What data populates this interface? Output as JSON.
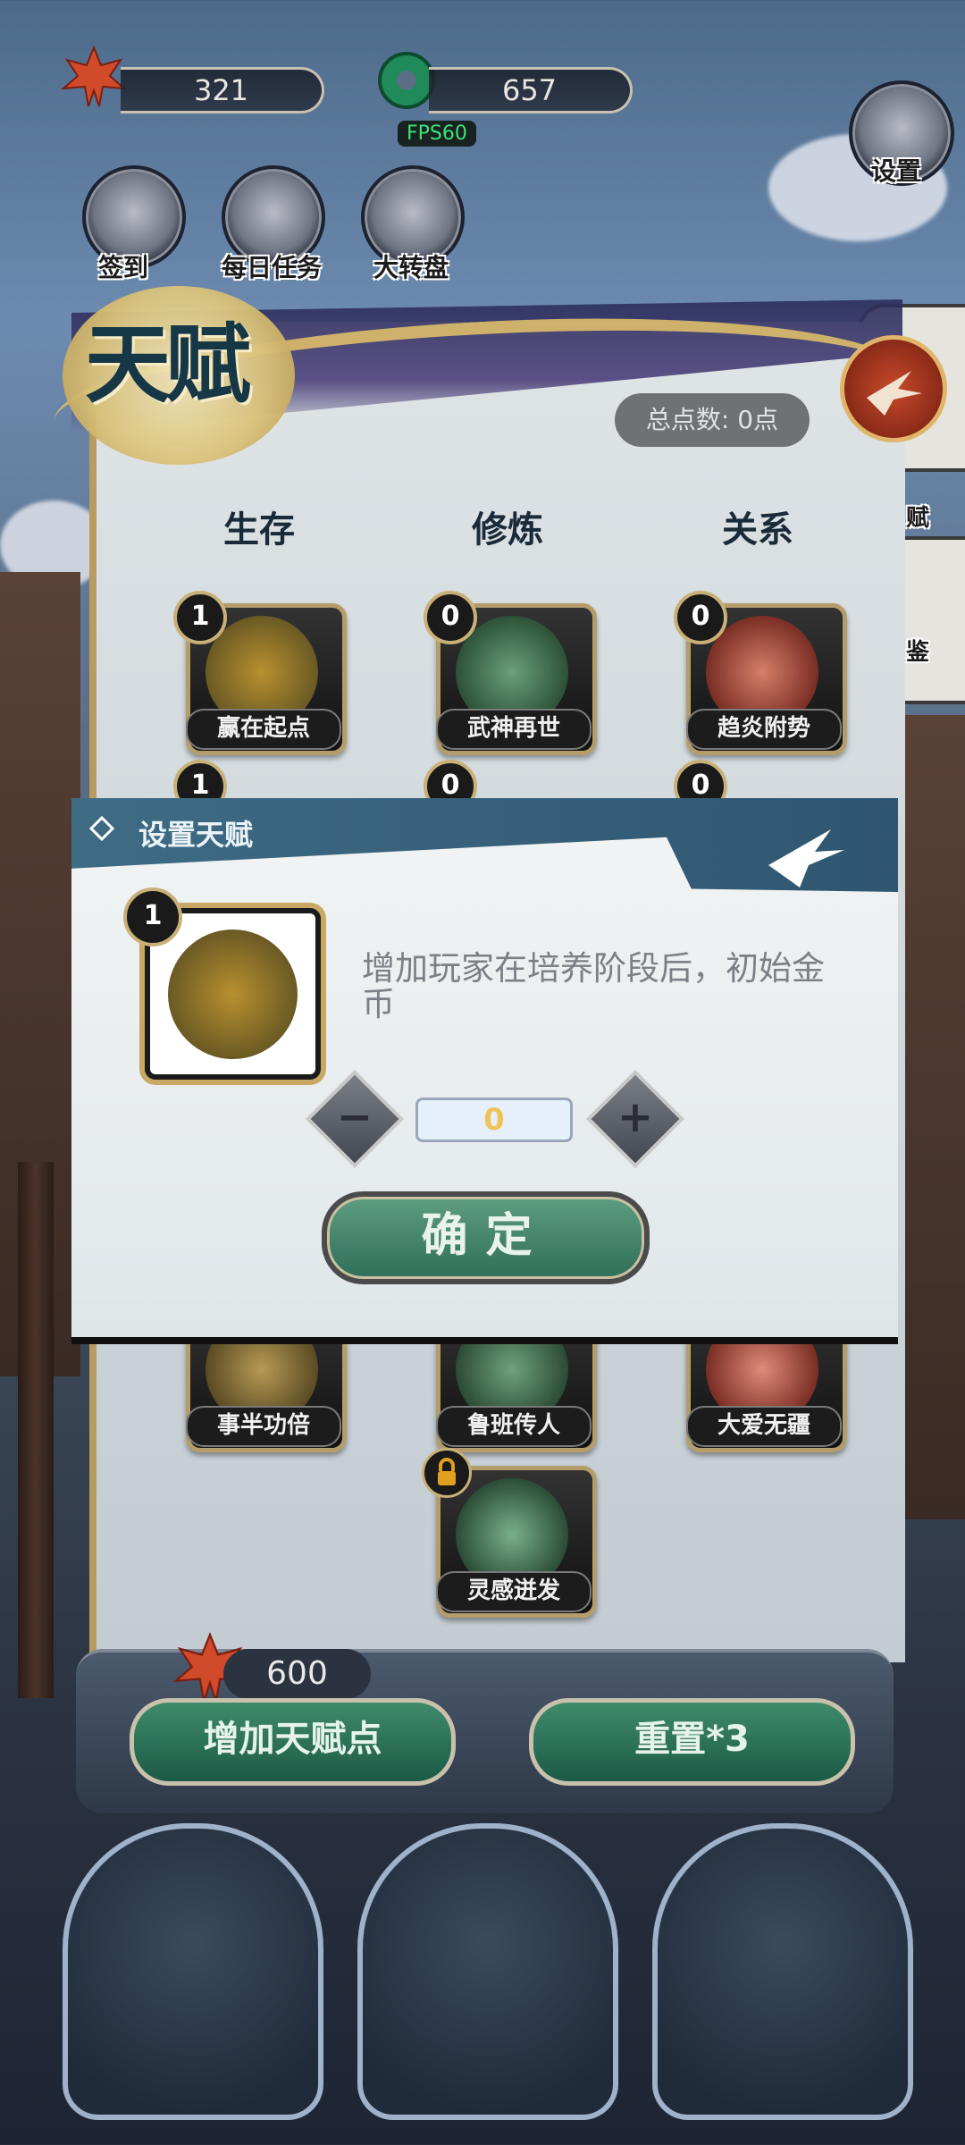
{
  "resources": {
    "leaf_count": "321",
    "jade_count": "657",
    "fps": "FPS60"
  },
  "top_buttons": [
    {
      "label": "签到"
    },
    {
      "label": "每日任务"
    },
    {
      "label": "大转盘"
    }
  ],
  "settings_label": "设置",
  "side_tabs": [
    {
      "label": "赋"
    },
    {
      "label": "鉴"
    }
  ],
  "talent_panel": {
    "title": "天赋",
    "total_points": "总点数: 0点",
    "columns": [
      "生存",
      "修炼",
      "关系"
    ],
    "tiles_row1": [
      {
        "name": "赢在起点",
        "level": "1"
      },
      {
        "name": "武神再世",
        "level": "0"
      },
      {
        "name": "趋炎附势",
        "level": "0"
      }
    ],
    "tiles_row2_levels": [
      "1",
      "0",
      "0"
    ],
    "tiles_row3": [
      {
        "name": "事半功倍"
      },
      {
        "name": "鲁班传人"
      },
      {
        "name": "大爱无疆"
      }
    ],
    "tile_row4": {
      "name": "灵感迸发"
    }
  },
  "dialog": {
    "title": "设置天赋",
    "item_level": "1",
    "description": "增加玩家在培养阶段后，初始金币",
    "quantity": "0",
    "minus": "−",
    "plus": "+",
    "confirm": "确定"
  },
  "bottom": {
    "cost": "600",
    "add_points": "增加天赋点",
    "reset": "重置*3"
  }
}
